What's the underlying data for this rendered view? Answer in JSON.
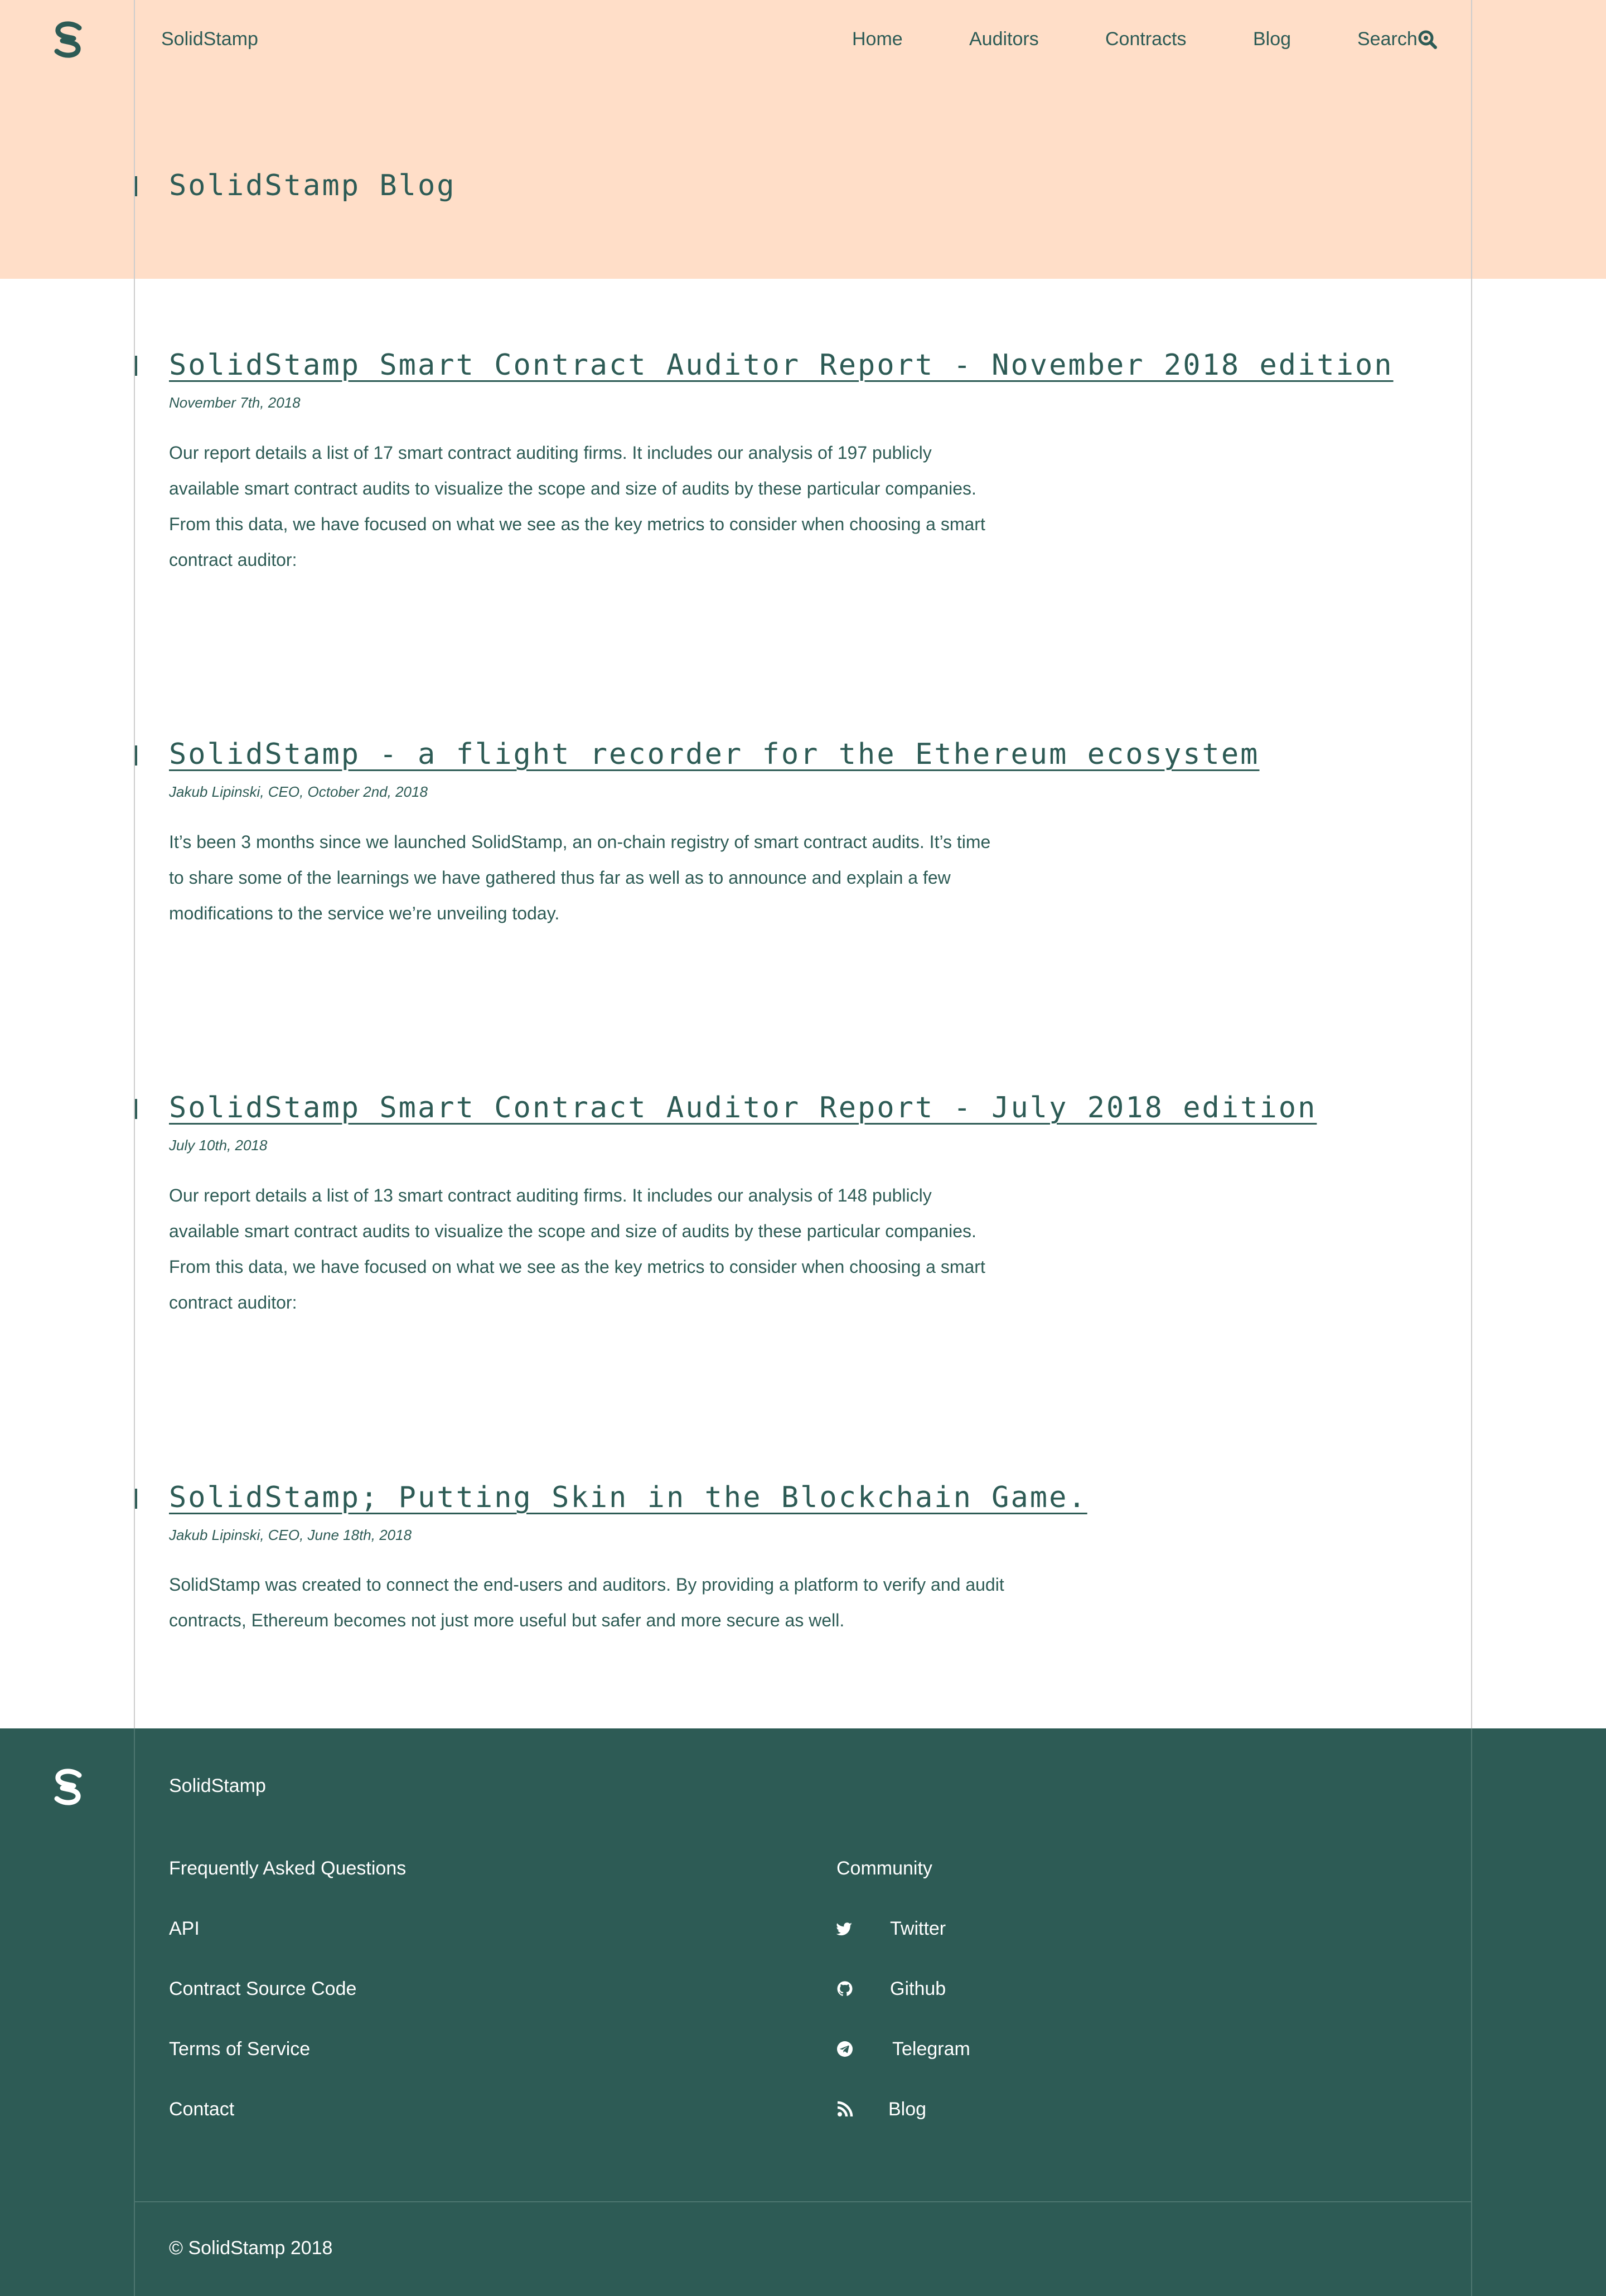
{
  "header": {
    "brand": "SolidStamp",
    "nav": {
      "home": "Home",
      "auditors": "Auditors",
      "contracts": "Contracts",
      "blog": "Blog",
      "search": "Search"
    },
    "title": "SolidStamp Blog"
  },
  "posts": [
    {
      "title": "SolidStamp Smart Contract Auditor Report - November 2018 edition",
      "meta": "November 7th, 2018",
      "excerpt": "Our report details a list of 17 smart contract auditing firms. It includes our analysis of 197 publicly available smart contract audits to visualize the scope and size of audits by these particular companies. From this data, we have focused on what we see as the key metrics to consider when choosing a smart contract auditor:"
    },
    {
      "title": "SolidStamp - a flight recorder for the Ethereum ecosystem",
      "meta": "Jakub Lipinski, CEO, October 2nd, 2018",
      "excerpt": "It’s been 3 months since we launched SolidStamp, an on-chain registry of smart contract audits. It’s time to share some of the learnings we have gathered thus far as well as to announce and explain a few modifications to the service we’re unveiling today."
    },
    {
      "title": "SolidStamp Smart Contract Auditor Report - July 2018 edition",
      "meta": "July 10th, 2018",
      "excerpt": "Our report details a list of 13 smart contract auditing firms. It includes our analysis of 148 publicly available smart contract audits to visualize the scope and size of audits by these particular companies. From this data, we have focused on what we see as the key metrics to consider when choosing a smart contract auditor:"
    },
    {
      "title": "SolidStamp; Putting Skin in the Blockchain Game.",
      "meta": "Jakub Lipinski, CEO, June 18th, 2018",
      "excerpt": "SolidStamp was created to connect the end-users and auditors. By providing a platform to verify and audit contracts, Ethereum becomes not just more useful but safer and more secure as well."
    }
  ],
  "footer": {
    "brand": "SolidStamp",
    "links": [
      "Frequently Asked Questions",
      "API",
      "Contract Source Code",
      "Terms of Service",
      "Contact"
    ],
    "community_heading": "Community",
    "community": [
      {
        "label": "Twitter",
        "icon": "twitter-icon"
      },
      {
        "label": "Github",
        "icon": "github-icon"
      },
      {
        "label": "Telegram",
        "icon": "telegram-icon"
      },
      {
        "label": "Blog",
        "icon": "rss-icon"
      }
    ],
    "copyright": "© SolidStamp 2018"
  },
  "colors": {
    "header_bg": "#ffdec8",
    "accent": "#2d5b55",
    "footer_bg": "#2d5b55",
    "guide_line": "#cdcdcd"
  }
}
